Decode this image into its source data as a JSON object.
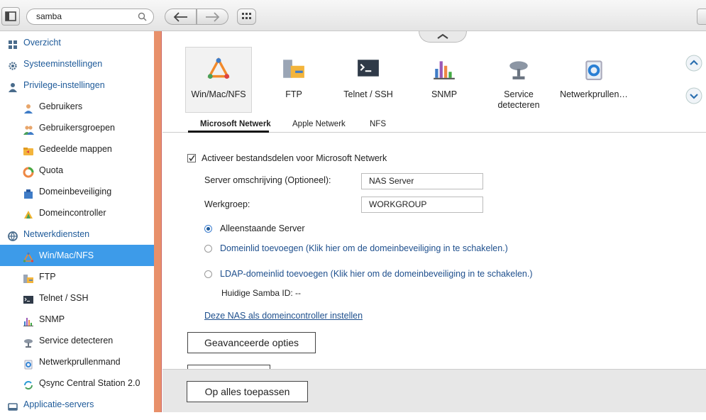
{
  "search": {
    "value": "samba"
  },
  "sidebar": {
    "items": [
      {
        "label": "Overzicht",
        "level": "top",
        "icon": "overview-icon"
      },
      {
        "label": "Systeeminstellingen",
        "level": "top",
        "icon": "gear-icon"
      },
      {
        "label": "Privilege-instellingen",
        "level": "top",
        "icon": "user-icon"
      },
      {
        "label": "Gebruikers",
        "level": "sub",
        "icon": "users-icon"
      },
      {
        "label": "Gebruikersgroepen",
        "level": "sub",
        "icon": "user-groups-icon"
      },
      {
        "label": "Gedeelde mappen",
        "level": "sub",
        "icon": "shared-folder-icon"
      },
      {
        "label": "Quota",
        "level": "sub",
        "icon": "quota-icon"
      },
      {
        "label": "Domeinbeveiliging",
        "level": "sub",
        "icon": "domain-security-icon"
      },
      {
        "label": "Domeincontroller",
        "level": "sub",
        "icon": "domain-controller-icon"
      },
      {
        "label": "Netwerkdiensten",
        "level": "top",
        "icon": "network-icon"
      },
      {
        "label": "Win/Mac/NFS",
        "level": "sub",
        "icon": "winmacnfs-icon",
        "active": true
      },
      {
        "label": "FTP",
        "level": "sub",
        "icon": "ftp-icon"
      },
      {
        "label": "Telnet / SSH",
        "level": "sub",
        "icon": "terminal-icon"
      },
      {
        "label": "SNMP",
        "level": "sub",
        "icon": "snmp-icon"
      },
      {
        "label": "Service detecteren",
        "level": "sub",
        "icon": "satellite-icon"
      },
      {
        "label": "Netwerkprullenmand",
        "level": "sub",
        "icon": "recycle-bin-icon"
      },
      {
        "label": "Qsync Central Station 2.0",
        "level": "sub",
        "icon": "qsync-icon"
      },
      {
        "label": "Applicatie-servers",
        "level": "top",
        "icon": "app-server-icon"
      }
    ]
  },
  "iconbar": {
    "items": [
      {
        "label": "Win/Mac/NFS",
        "icon": "winmacnfs-icon"
      },
      {
        "label": "FTP",
        "icon": "ftp-icon"
      },
      {
        "label": "Telnet / SSH",
        "icon": "terminal-icon"
      },
      {
        "label": "SNMP",
        "icon": "snmp-icon"
      },
      {
        "label": "Service detecteren",
        "icon": "satellite-icon"
      },
      {
        "label": "Netwerkprullen…",
        "icon": "recycle-bin-icon"
      }
    ]
  },
  "tabs": [
    "Microsoft Netwerk",
    "Apple Netwerk",
    "NFS"
  ],
  "form": {
    "enable_label": "Activeer bestandsdelen voor Microsoft Netwerk",
    "server_desc_label": "Server omschrijving (Optioneel):",
    "server_desc_value": "NAS Server",
    "workgroup_label": "Werkgroep:",
    "workgroup_value": "WORKGROUP",
    "radio_standalone": "Alleenstaande Server",
    "radio_domain": "Domeinlid toevoegen (Klik hier om de domeinbeveiliging in te schakelen.)",
    "radio_ldap": "LDAP-domeinlid toevoegen (Klik hier om de domeinbeveiliging in te schakelen.)",
    "samba_id": "Huidige Samba ID: --",
    "dc_link": "Deze NAS als domeincontroller instellen",
    "advanced_button": "Geavanceerde opties"
  },
  "footer": {
    "apply_button": "Op alles toepassen"
  },
  "colors": {
    "accent": "#3d9be9",
    "divider": "#e8906a",
    "link": "#1e4f8d"
  }
}
